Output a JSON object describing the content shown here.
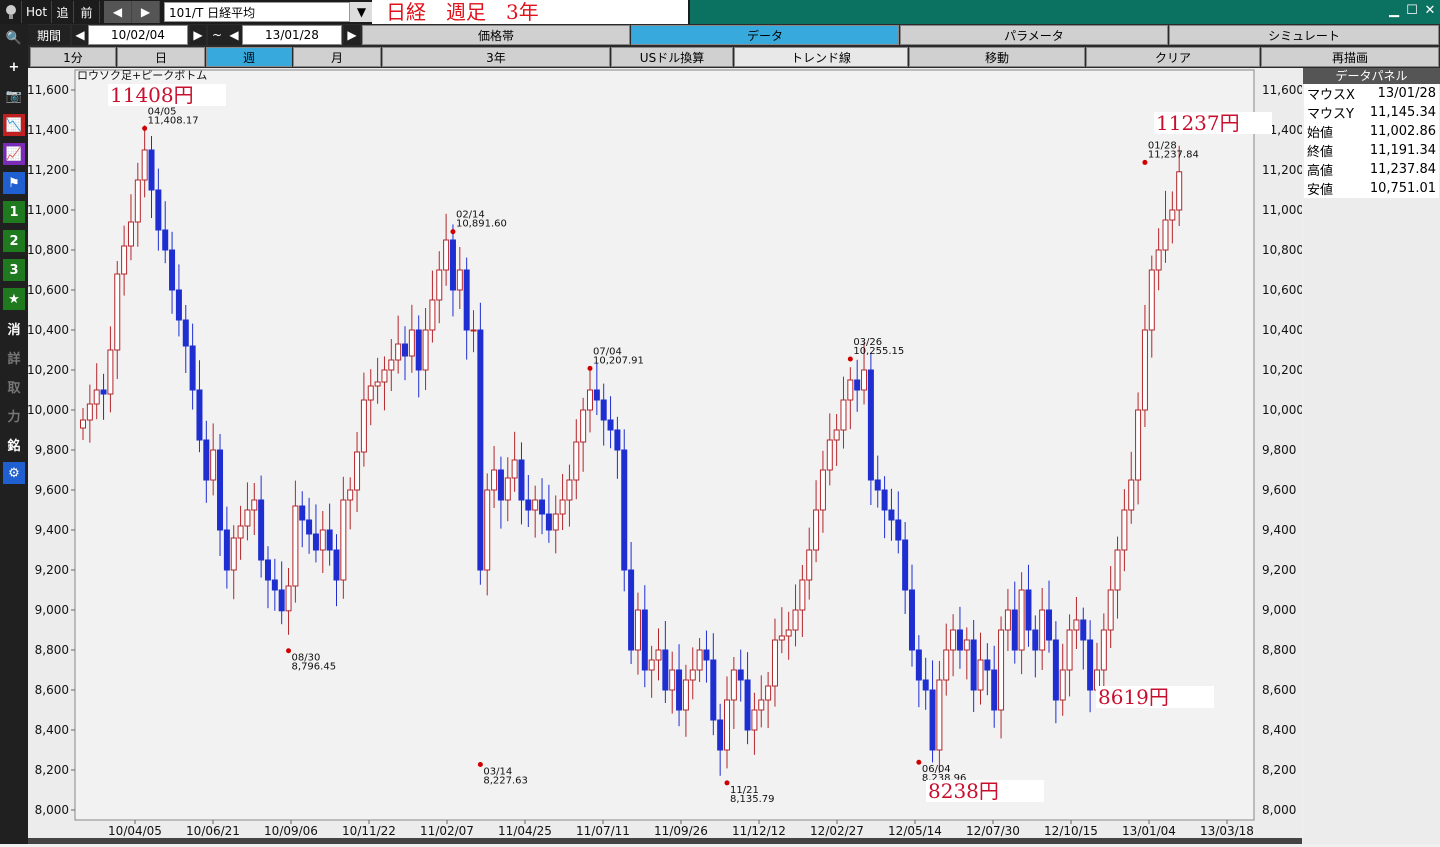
{
  "toolbar": {
    "hot": "Hot",
    "follow": "追",
    "prev": "前",
    "symbol": "101/T 日経平均",
    "title": "日経　週足　3年"
  },
  "row1": {
    "period_label": "期間",
    "from": "10/02/04",
    "tilde": "~",
    "to": "13/01/28",
    "tabs": [
      "価格帯",
      "データ",
      "パラメータ",
      "シミュレート"
    ],
    "active_tab": "データ"
  },
  "row2": {
    "intervals": [
      "1分",
      "日",
      "週",
      "月",
      "3年"
    ],
    "active_interval": "週",
    "buttons": [
      "USドル換算",
      "トレンド線",
      "移動",
      "クリア",
      "再描画"
    ]
  },
  "left_tools": [
    {
      "icon": "search-icon",
      "glyph": "🔍"
    },
    {
      "icon": "crosshair-icon",
      "glyph": "+"
    },
    {
      "icon": "camera-icon",
      "glyph": "📷"
    },
    {
      "icon": "chart-red-icon",
      "glyph": "📉"
    },
    {
      "icon": "chart-purple-icon",
      "glyph": "📈"
    },
    {
      "icon": "flag-icon",
      "glyph": "⚑"
    },
    {
      "icon": "preset-1",
      "glyph": "1"
    },
    {
      "icon": "preset-2",
      "glyph": "2"
    },
    {
      "icon": "preset-3",
      "glyph": "3"
    },
    {
      "icon": "star-icon",
      "glyph": "★"
    },
    {
      "icon": "erase",
      "glyph": "消"
    },
    {
      "icon": "detail",
      "glyph": "詳"
    },
    {
      "icon": "take",
      "glyph": "取"
    },
    {
      "icon": "power",
      "glyph": "力"
    },
    {
      "icon": "brand",
      "glyph": "銘"
    },
    {
      "icon": "gear-icon",
      "glyph": "⚙"
    }
  ],
  "panel": {
    "title": "データパネル",
    "rows": [
      [
        "マウスX",
        "13/01/28"
      ],
      [
        "マウスY",
        "11,145.34"
      ],
      [
        "始値",
        "11,002.86"
      ],
      [
        "終値",
        "11,191.34"
      ],
      [
        "高値",
        "11,237.84"
      ],
      [
        "安値",
        "10,751.01"
      ]
    ]
  },
  "colors": {
    "up": "#b3262b",
    "down": "#1f2ed0",
    "peak": "#d10000"
  },
  "chart_data": {
    "type": "candlestick",
    "title": "ロウソク足+ピークボトム",
    "ylim": [
      7950,
      11700
    ],
    "yticks": [
      8000,
      8200,
      8400,
      8600,
      8800,
      9000,
      9200,
      9400,
      9600,
      9800,
      10000,
      10200,
      10400,
      10600,
      10800,
      11000,
      11200,
      11400,
      11600
    ],
    "xticks": [
      "10/04/05",
      "10/06/21",
      "10/09/06",
      "10/11/22",
      "11/02/07",
      "11/04/25",
      "11/07/11",
      "11/09/26",
      "11/12/12",
      "12/02/27",
      "12/05/14",
      "12/07/30",
      "12/10/15",
      "13/01/04",
      "13/03/18"
    ],
    "peaks": [
      {
        "date": "04/05",
        "value": "11,408.17",
        "price": 11408.17,
        "week": 9
      },
      {
        "date": "08/30",
        "value": "8,796.45",
        "price": 8796.45,
        "week": 30
      },
      {
        "date": "02/14",
        "value": "10,891.60",
        "price": 10891.6,
        "week": 54
      },
      {
        "date": "03/14",
        "value": "8,227.63",
        "price": 8227.63,
        "week": 58
      },
      {
        "date": "07/04",
        "value": "10,207.91",
        "price": 10207.91,
        "week": 74
      },
      {
        "date": "11/21",
        "value": "8,135.79",
        "price": 8135.79,
        "week": 94
      },
      {
        "date": "03/26",
        "value": "10,255.15",
        "price": 10255.15,
        "week": 112
      },
      {
        "date": "06/04",
        "value": "8,238.96",
        "price": 8238.96,
        "week": 122
      },
      {
        "date": "01/28",
        "value": "11,237.84",
        "price": 11237.84,
        "week": 155
      }
    ],
    "annotations": [
      "11408円",
      "11237円",
      "8619円",
      "8238円"
    ],
    "closes": [
      9950,
      10030,
      10100,
      10080,
      10300,
      10680,
      10820,
      10940,
      11150,
      11300,
      11100,
      10900,
      10800,
      10600,
      10450,
      10320,
      10100,
      9850,
      9650,
      9800,
      9400,
      9200,
      9360,
      9420,
      9500,
      9550,
      9250,
      9150,
      9100,
      8996,
      9120,
      9520,
      9450,
      9380,
      9300,
      9400,
      9300,
      9150,
      9550,
      9600,
      9790,
      10050,
      10120,
      10140,
      10200,
      10250,
      10330,
      10270,
      10400,
      10200,
      10400,
      10550,
      10700,
      10850,
      10600,
      10700,
      10400,
      10400,
      9200,
      9600,
      9700,
      9550,
      9660,
      9750,
      9550,
      9500,
      9550,
      9480,
      9400,
      9480,
      9550,
      9650,
      9840,
      10000,
      10100,
      10050,
      9950,
      9900,
      9800,
      9200,
      8800,
      9000,
      8700,
      8750,
      8800,
      8600,
      8700,
      8500,
      8650,
      8700,
      8800,
      8750,
      8450,
      8300,
      8550,
      8700,
      8650,
      8400,
      8500,
      8550,
      8620,
      8850,
      8870,
      8900,
      9000,
      9150,
      9300,
      9500,
      9700,
      9850,
      9900,
      10050,
      10150,
      10100,
      10200,
      9650,
      9600,
      9500,
      9450,
      9350,
      9100,
      8800,
      8650,
      8600,
      8300,
      8650,
      8800,
      8900,
      8800,
      8850,
      8600,
      8750,
      8700,
      8500,
      8900,
      9000,
      8800,
      9100,
      8900,
      8800,
      9000,
      8850,
      8550,
      8700,
      8900,
      8950,
      8850,
      8600,
      8700,
      8900,
      9100,
      9300,
      9500,
      9650,
      10000,
      10400,
      10700,
      10800,
      10950,
      11000,
      11191
    ]
  }
}
